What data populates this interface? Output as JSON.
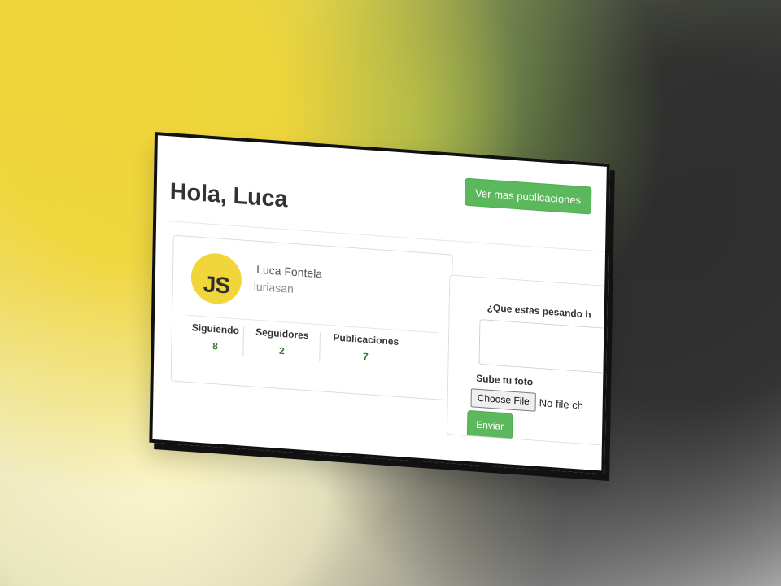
{
  "page": {
    "title": "Hola, Luca",
    "top_button_label": "Ver mas publicaciones"
  },
  "profile": {
    "avatar_text": "JS",
    "name": "Luca Fontela",
    "username": "luriasan",
    "stats": [
      {
        "label": "Siguiendo",
        "value": "8"
      },
      {
        "label": "Seguidores",
        "value": "2"
      },
      {
        "label": "Publicaciones",
        "value": "7"
      }
    ]
  },
  "composer": {
    "prompt": "¿Que estas pesando h",
    "photo_label": "Sube tu foto",
    "file_button_label": "Choose File",
    "file_status": "No file ch",
    "submit_label": "Enviar"
  },
  "colors": {
    "accent": "#5cb85c",
    "avatar_bg": "#f0d63a",
    "stat_value": "#2e7d32"
  },
  "icons": {
    "avatar": "js-logo-icon"
  }
}
